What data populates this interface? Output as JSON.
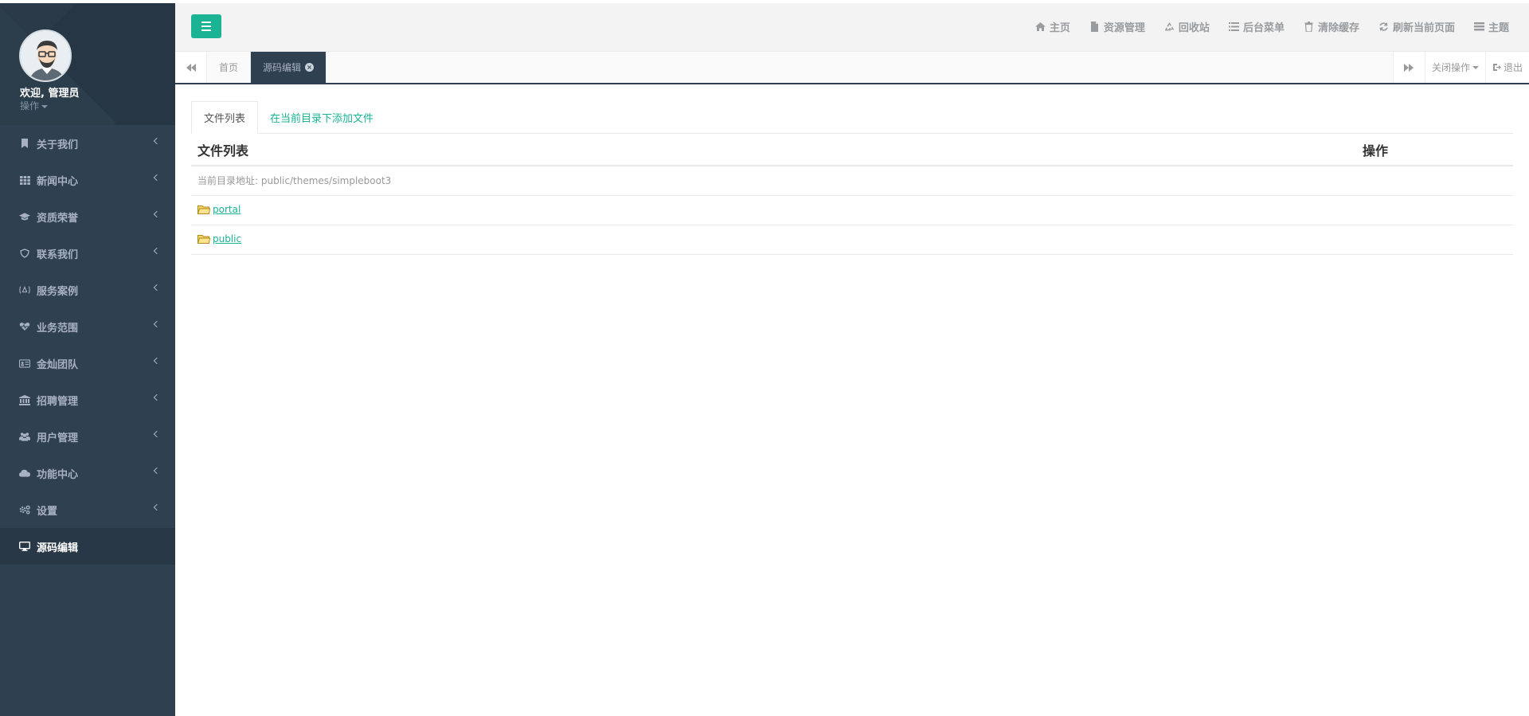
{
  "sidebar": {
    "welcome": "欢迎, 管理员",
    "ops_label": "操作",
    "items": [
      {
        "label": "关于我们",
        "icon": "bookmark-icon"
      },
      {
        "label": "新闻中心",
        "icon": "grid-icon"
      },
      {
        "label": "资质荣誉",
        "icon": "graduation-cap-icon"
      },
      {
        "label": "联系我们",
        "icon": "shield-icon"
      },
      {
        "label": "服务案例",
        "icon": "badge-icon"
      },
      {
        "label": "业务范围",
        "icon": "heartbeat-icon"
      },
      {
        "label": "金灿团队",
        "icon": "id-card-icon"
      },
      {
        "label": "招聘管理",
        "icon": "bank-icon"
      },
      {
        "label": "用户管理",
        "icon": "users-icon"
      },
      {
        "label": "功能中心",
        "icon": "cloud-icon"
      },
      {
        "label": "设置",
        "icon": "cogs-icon"
      },
      {
        "label": "源码编辑",
        "icon": "desktop-icon",
        "active": true
      }
    ]
  },
  "header": {
    "links": [
      {
        "label": "主页",
        "icon": "home-icon"
      },
      {
        "label": "资源管理",
        "icon": "file-icon"
      },
      {
        "label": "回收站",
        "icon": "recycle-icon"
      },
      {
        "label": "后台菜单",
        "icon": "list-icon"
      },
      {
        "label": "清除缓存",
        "icon": "trash-icon"
      },
      {
        "label": "刷新当前页面",
        "icon": "refresh-icon"
      },
      {
        "label": "主题",
        "icon": "theme-icon"
      }
    ]
  },
  "tabsbar": {
    "tabs": [
      {
        "label": "首页"
      },
      {
        "label": "源码编辑",
        "active": true
      }
    ],
    "close_ops": "关闭操作",
    "logout": "退出"
  },
  "content": {
    "tabs": [
      {
        "label": "文件列表",
        "active": true
      },
      {
        "label": "在当前目录下添加文件"
      }
    ],
    "table": {
      "headers": [
        "文件列表",
        "操作"
      ],
      "path_label": "当前目录地址: public/themes/simpleboot3",
      "folders": [
        "portal",
        "public"
      ]
    }
  },
  "colors": {
    "sidebar_bg": "#2f4050",
    "accent": "#1ab394",
    "header_bg": "#f3f3f4"
  }
}
